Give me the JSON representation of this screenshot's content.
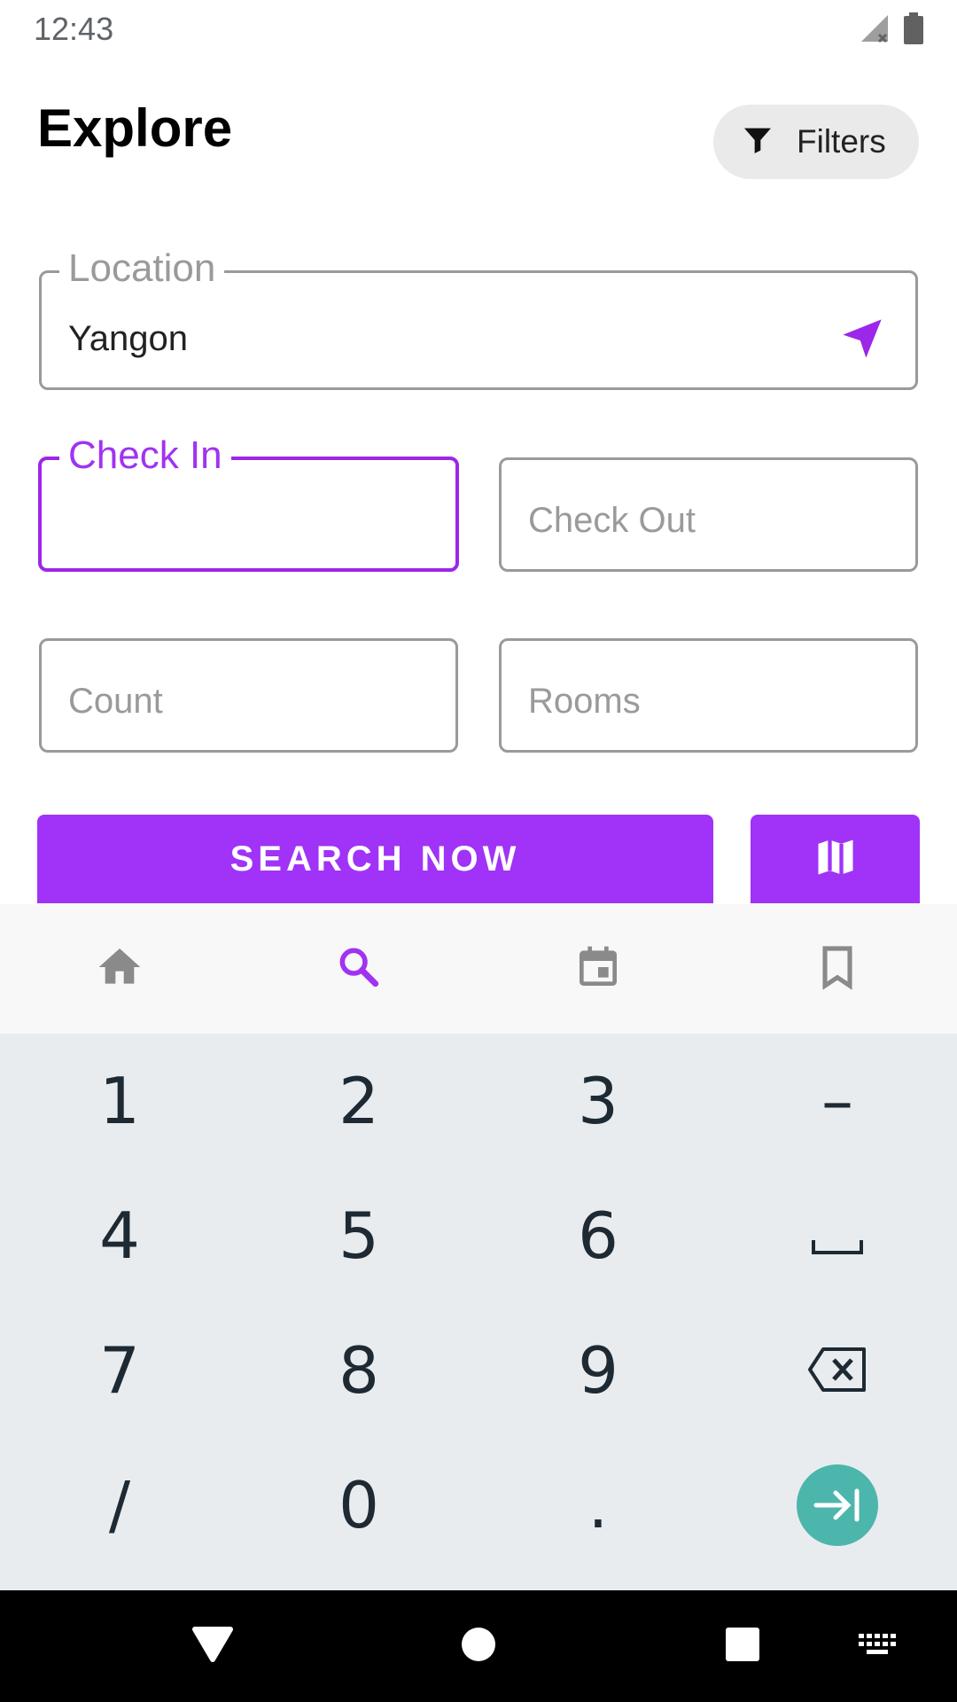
{
  "status_bar": {
    "time": "12:43",
    "icons": [
      "signal-icon",
      "battery-icon"
    ]
  },
  "header": {
    "title": "Explore",
    "filters_label": "Filters",
    "filters_icon": "filter-icon"
  },
  "form": {
    "location": {
      "label": "Location",
      "value": "Yangon",
      "icon": "navigation-arrow-icon"
    },
    "check_in": {
      "label": "Check In",
      "value": ""
    },
    "check_out": {
      "placeholder": "Check Out"
    },
    "count": {
      "placeholder": "Count"
    },
    "rooms": {
      "placeholder": "Rooms"
    }
  },
  "actions": {
    "search_label": "SEARCH NOW",
    "map_icon": "map-icon"
  },
  "bottom_nav": {
    "items": [
      {
        "name": "home",
        "icon": "home-icon",
        "active": false
      },
      {
        "name": "search",
        "icon": "search-icon",
        "active": true
      },
      {
        "name": "bookings",
        "icon": "calendar-icon",
        "active": false
      },
      {
        "name": "saved",
        "icon": "bookmark-icon",
        "active": false
      }
    ]
  },
  "keyboard": {
    "rows": [
      [
        "1",
        "2",
        "3",
        "–"
      ],
      [
        "4",
        "5",
        "6",
        "space"
      ],
      [
        "7",
        "8",
        "9",
        "backspace"
      ],
      [
        "/",
        "0",
        ".",
        "next"
      ]
    ]
  },
  "colors": {
    "accent": "#a033f7",
    "text_hint": "#9a9a9a",
    "nav_inactive": "#8a8a8a",
    "keyboard_bg": "#e9ecef",
    "go_key": "#4db6ac"
  }
}
